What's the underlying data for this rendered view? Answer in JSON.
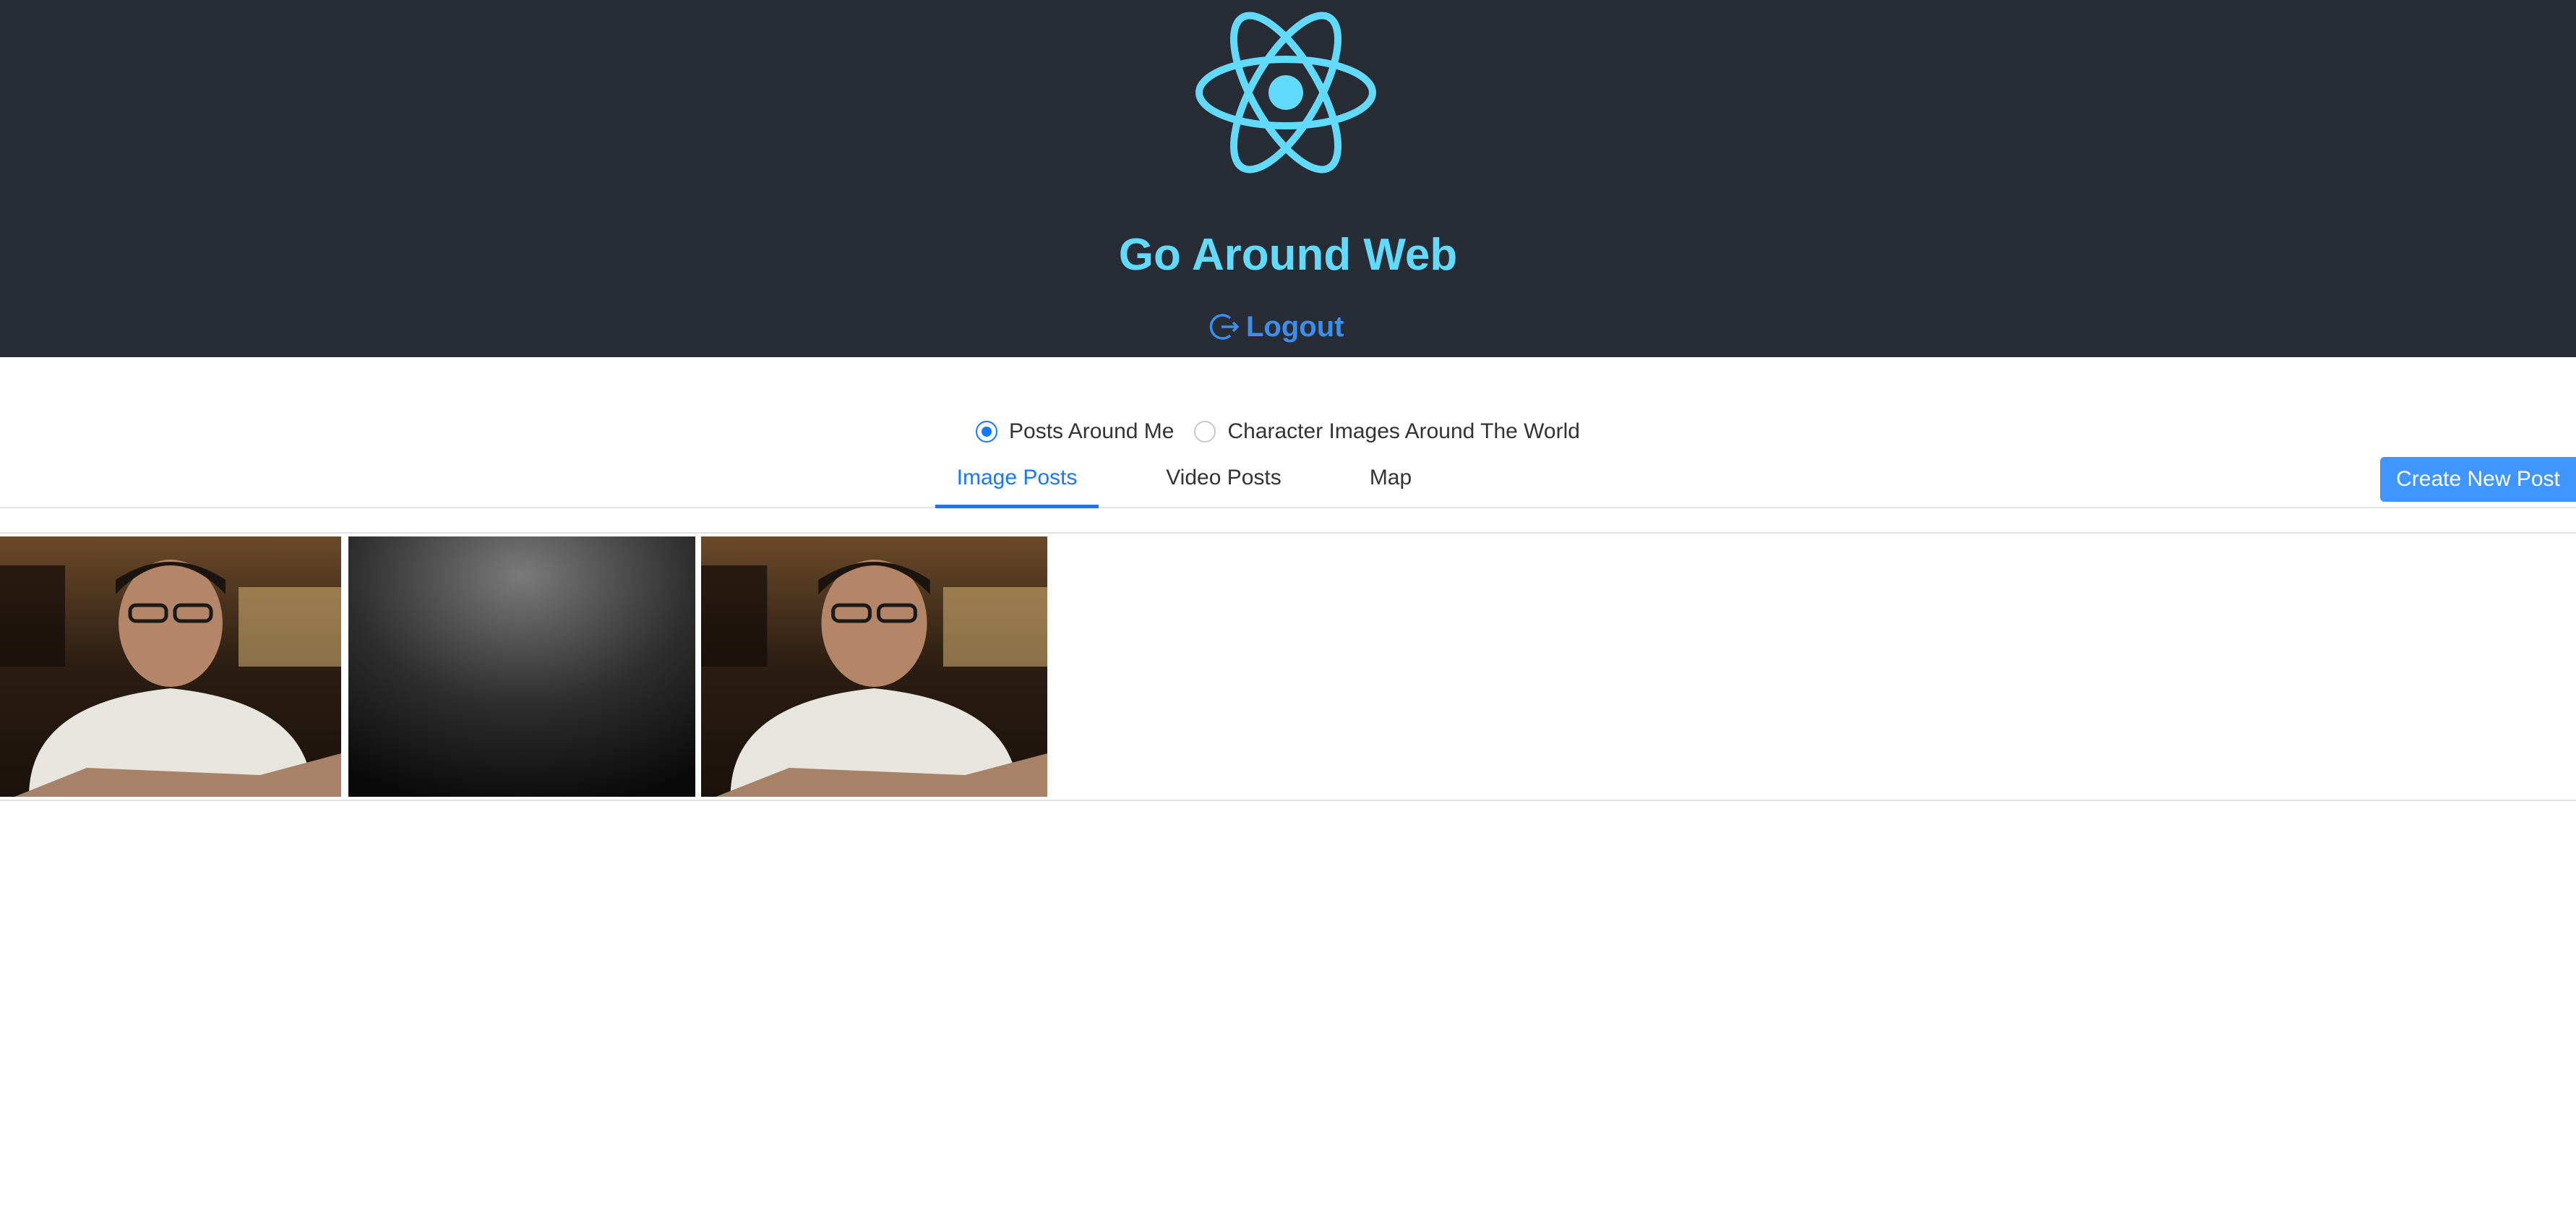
{
  "header": {
    "logo_icon": "react-atom-icon",
    "title": "Go Around Web",
    "logout_label": "Logout",
    "logout_icon": "logout-icon"
  },
  "filter": {
    "options": [
      {
        "label": "Posts Around Me",
        "checked": true
      },
      {
        "label": "Character Images Around The World",
        "checked": false
      }
    ]
  },
  "tabs": [
    {
      "label": "Image Posts",
      "active": true
    },
    {
      "label": "Video Posts",
      "active": false
    },
    {
      "label": "Map",
      "active": false
    }
  ],
  "actions": {
    "create_label": "Create New Post"
  },
  "gallery": {
    "images": [
      {
        "type": "person-photo"
      },
      {
        "type": "dark-texture"
      },
      {
        "type": "person-photo"
      }
    ]
  },
  "colors": {
    "header_bg": "#282c34",
    "accent": "#61dafb",
    "primary": "#1677ff",
    "logout": "#3b8ff0"
  }
}
